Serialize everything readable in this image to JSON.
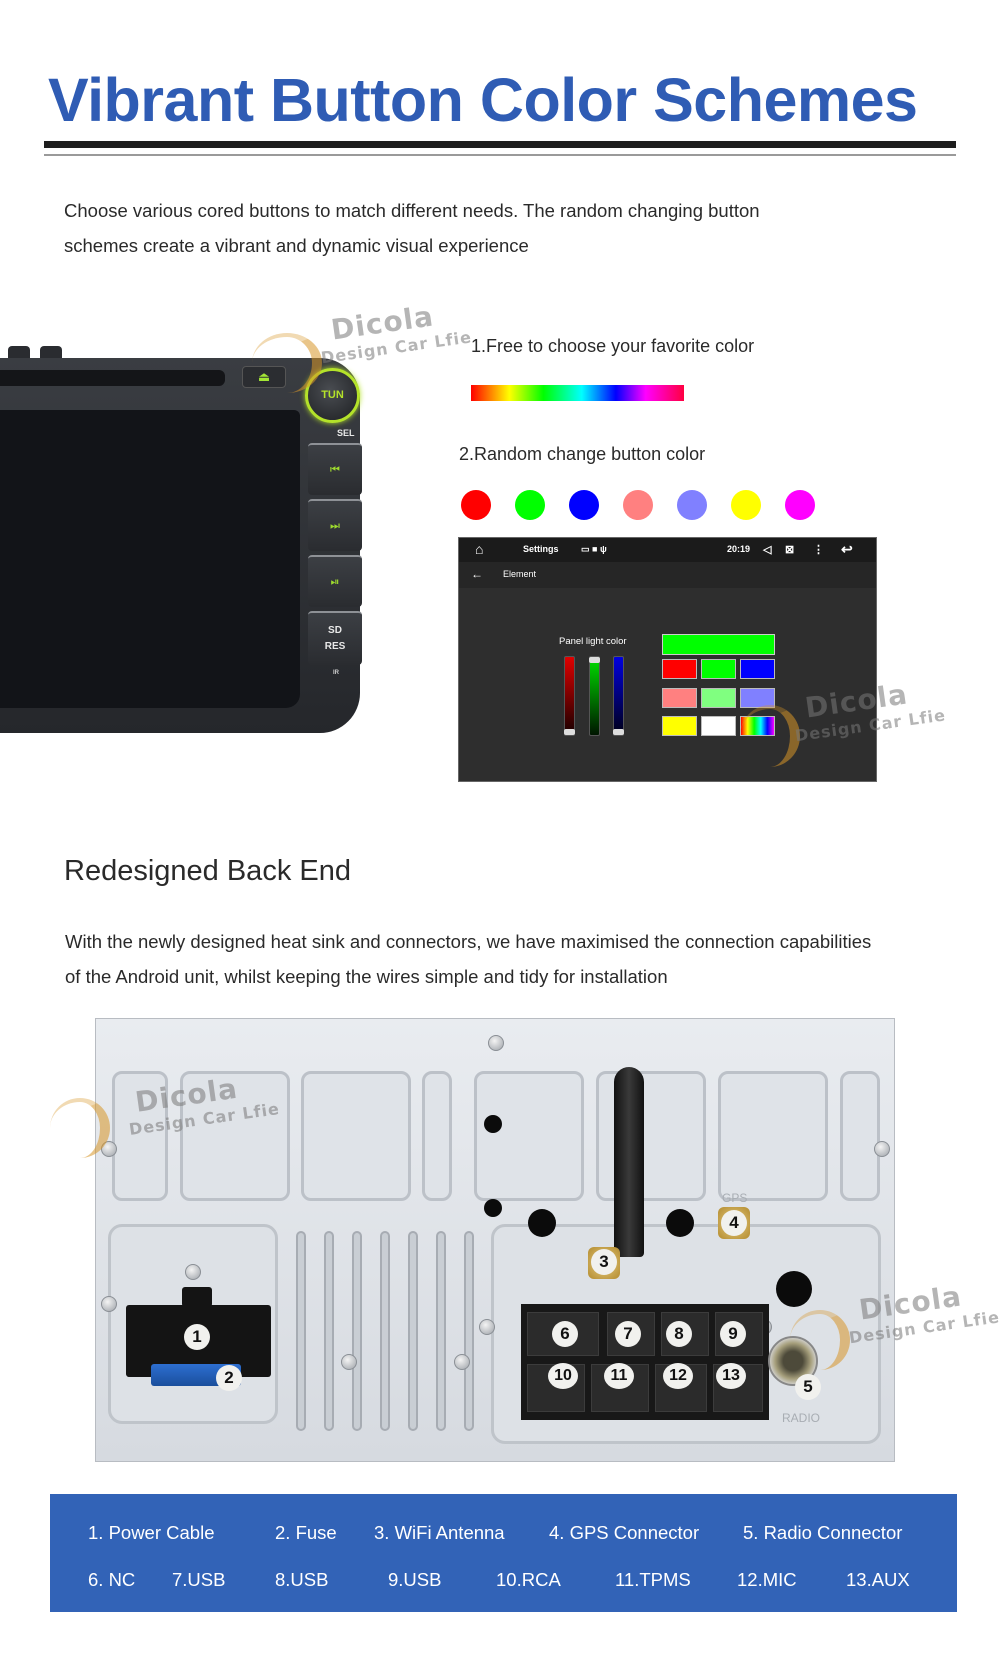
{
  "header": {
    "title": "Vibrant Button Color Schemes",
    "title_color": "#2f5cb4"
  },
  "intro": {
    "line1": "Choose various cored buttons to match different needs. The random changing button",
    "line2": "schemes create a vibrant and dynamic visual experience"
  },
  "watermark": {
    "brand": "Dicola",
    "tagline": "Design Car Lfie"
  },
  "head_unit": {
    "knob_label": "TUN",
    "sel_label": "SEL",
    "buttons": [
      {
        "icon": "skip-previous-icon",
        "glyph": "⏮"
      },
      {
        "icon": "skip-next-icon",
        "glyph": "⏭"
      },
      {
        "icon": "play-pause-icon",
        "glyph": "⏯"
      }
    ],
    "sd_label": "SD",
    "res_label": "RES",
    "ir_label": "IR",
    "eject_glyph": "⏏",
    "accent_color": "#b4e22a"
  },
  "color_features": {
    "feature1": "1.Free to choose your favorite color",
    "feature2": "2.Random change button color",
    "swatches": [
      "#ff0000",
      "#00ff00",
      "#0000ff",
      "#ff8080",
      "#8080ff",
      "#ffff00",
      "#ff00ff"
    ]
  },
  "android_screen": {
    "status_bar": {
      "home_glyph": "⌂",
      "app_title": "Settings",
      "notif_glyphs": "▭ ■ ψ",
      "time": "20:19",
      "volume_glyph": "◁",
      "screen_glyph": "⊠",
      "menu_glyph": "⋮",
      "back_glyph": "↩"
    },
    "app_bar": {
      "back_arrow": "←",
      "title": "Element"
    },
    "panel_label": "Panel light color",
    "rgb_sliders": [
      {
        "name": "red",
        "value": 0
      },
      {
        "name": "green",
        "value": 255
      },
      {
        "name": "blue",
        "value": 0
      }
    ],
    "selected_color": "#00ff00",
    "color_grid": [
      [
        "#ff0000",
        "#00ff00",
        "#0000ff"
      ],
      [
        "#ff8080",
        "#80ff80",
        "#8080ff"
      ],
      [
        "#ffff00",
        "#ffffff",
        "rainbow"
      ]
    ]
  },
  "backend": {
    "title": "Redesigned Back End",
    "line1": "With the newly designed heat sink and connectors, we have maximised the connection capabilities",
    "line2": "of the Android unit, whilst keeping the wires simple and tidy for installation",
    "gps_engraving": "GPS",
    "radio_engraving": "RADIO",
    "badges": [
      "1",
      "2",
      "3",
      "4",
      "5",
      "6",
      "7",
      "8",
      "9",
      "10",
      "11",
      "12",
      "13"
    ]
  },
  "legend": {
    "row1": [
      "1. Power Cable",
      "2. Fuse",
      "3. WiFi Antenna",
      "4. GPS Connector",
      "5. Radio Connector"
    ],
    "row2": [
      "6. NC",
      "7.USB",
      "8.USB",
      "9.USB",
      "10.RCA",
      "11.TPMS",
      "12.MIC",
      "13.AUX"
    ],
    "background_color": "#3263b7"
  }
}
